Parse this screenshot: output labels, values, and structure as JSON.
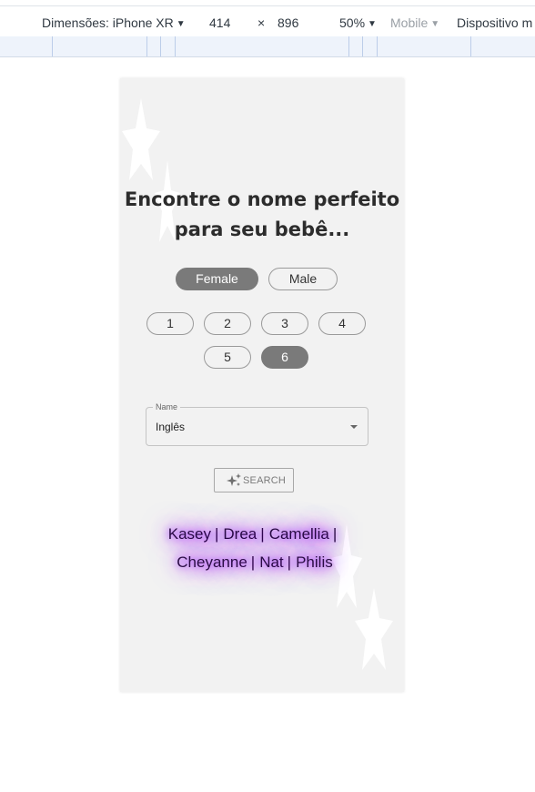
{
  "devtools": {
    "dimensions_label": "Dimensões: iPhone XR",
    "width": "414",
    "times": "×",
    "height": "896",
    "zoom": "50%",
    "mode": "Mobile",
    "device_label": "Dispositivo m"
  },
  "app": {
    "heading_line1": "Encontre o nome perfeito",
    "heading_line2": "para seu bebê...",
    "genders": [
      {
        "label": "Female",
        "selected": true
      },
      {
        "label": "Male",
        "selected": false
      }
    ],
    "counts": [
      {
        "label": "1",
        "selected": false
      },
      {
        "label": "2",
        "selected": false
      },
      {
        "label": "3",
        "selected": false
      },
      {
        "label": "4",
        "selected": false
      },
      {
        "label": "5",
        "selected": false
      },
      {
        "label": "6",
        "selected": true
      }
    ],
    "name_field": {
      "label": "Name",
      "value": "Inglês"
    },
    "search_button": "SEARCH",
    "results": [
      "Kasey",
      "Drea",
      "Camellia",
      "Cheyanne",
      "Nat",
      "Philis"
    ],
    "separator": "|"
  },
  "colors": {
    "selected_pill": "#7a7a7a",
    "background": "#f2f2f2",
    "glow": "#b042ff"
  }
}
